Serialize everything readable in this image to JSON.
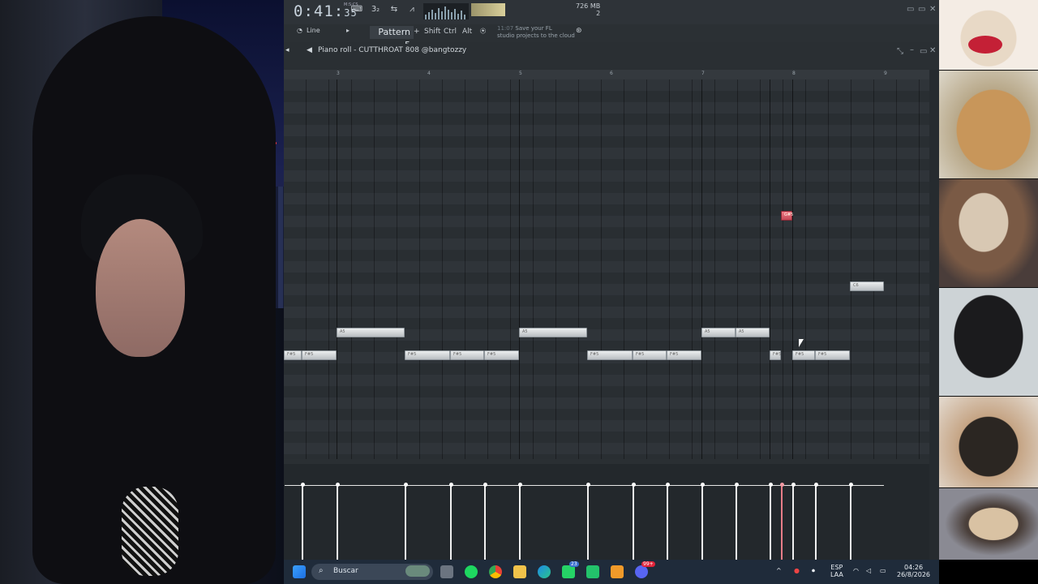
{
  "transport": {
    "time_main": "0:41",
    "time_small": "35",
    "time_label": "M:S:CS",
    "step_label": "3₂",
    "memory": "726 MB",
    "memory_row2": "b",
    "cpu_row2": "2"
  },
  "toolbar": {
    "snap": "Line",
    "pattern": "Pattern 5",
    "modifiers": [
      "Shift",
      "Ctrl",
      "Alt"
    ],
    "hint_time": "11:07",
    "hint_line1": "Save your FL",
    "hint_line2": "studio projects to the cloud"
  },
  "piano_roll": {
    "title": "Piano roll - CUTTHROAT 808 @bangtozzy",
    "ruler_labels": [
      "3",
      "4",
      "5",
      "6",
      "7",
      "8",
      "9"
    ],
    "note_label_f": "F#5",
    "note_label_g": "G#5",
    "note_label_c": "C6",
    "note_label_a": "A5"
  },
  "taskbar": {
    "search_placeholder": "Buscar",
    "lang_top": "ESP",
    "lang_bottom": "LAA",
    "clock_time": "04:26",
    "clock_date": "26/8/2026",
    "badge_whatsapp": "23",
    "badge_discord": "99+"
  },
  "colors": {
    "note": "#e0e3e5",
    "note_selected": "#e06574",
    "grid_bg": "#2b3035",
    "taskbar": "#1f2b3a"
  }
}
